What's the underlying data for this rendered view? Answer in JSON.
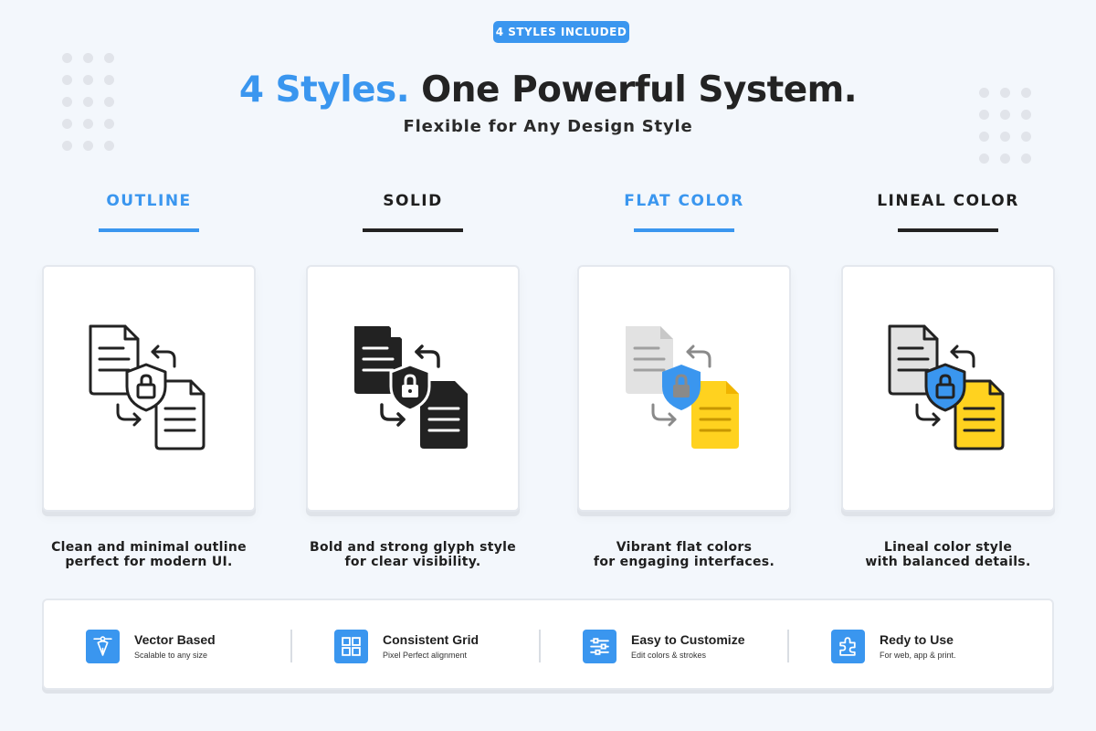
{
  "badge": "4 STYLES INCLUDED",
  "headline": {
    "accent": "4 Styles.",
    "rest": "One Powerful System."
  },
  "subhead": "Flexible for Any Design Style",
  "styles": [
    {
      "label": "OUTLINE",
      "desc_line1": "Clean and minimal outline",
      "desc_line2": "perfect for modern UI."
    },
    {
      "label": "SOLID",
      "desc_line1": "Bold and strong glyph style",
      "desc_line2": "for clear visibility."
    },
    {
      "label": "FLAT COLOR",
      "desc_line1": "Vibrant flat colors",
      "desc_line2": "for engaging interfaces."
    },
    {
      "label": "LINEAL COLOR",
      "desc_line1": "Lineal color style",
      "desc_line2": "with balanced details."
    }
  ],
  "features": [
    {
      "title": "Vector Based",
      "sub": "Scalable to any size",
      "icon": "pen-tool-icon"
    },
    {
      "title": "Consistent Grid",
      "sub": "Pixel Perfect alignment",
      "icon": "grid-icon"
    },
    {
      "title": "Easy to Customize",
      "sub": "Edit colors & strokes",
      "icon": "sliders-icon"
    },
    {
      "title": "Redy to Use",
      "sub": "For web, app & print.",
      "icon": "puzzle-icon"
    }
  ],
  "colors": {
    "accent": "#3a96ef",
    "dark": "#232323",
    "yellow": "#ffd21f",
    "gray": "#e2e2e2",
    "background": "#f3f7fc"
  }
}
